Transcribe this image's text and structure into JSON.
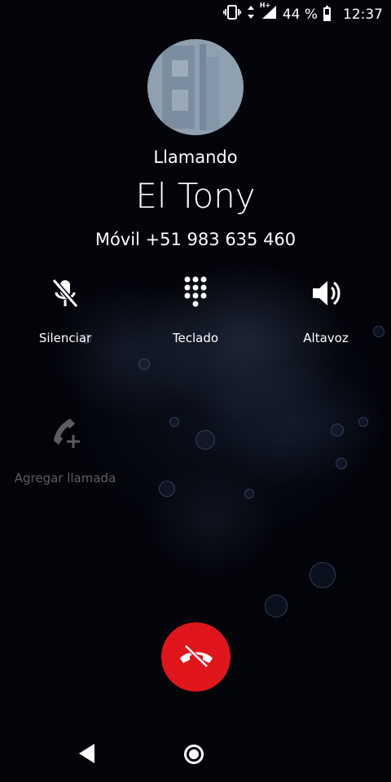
{
  "status_bar": {
    "battery_text": "44 %",
    "battery_level": 0.44,
    "network_type": "H+",
    "time": "12:37",
    "icons": [
      "vibrate-icon",
      "data-arrows-icon",
      "signal-icon",
      "battery-icon"
    ]
  },
  "call": {
    "state": "Llamando",
    "contact_name": "El Tony",
    "number_line": "Móvil +51 983 635 460"
  },
  "actions": [
    {
      "label": "Silenciar",
      "icon": "mute-mic-icon",
      "enabled": true
    },
    {
      "label": "Teclado",
      "icon": "dialpad-icon",
      "enabled": true
    },
    {
      "label": "Altavoz",
      "icon": "speaker-icon",
      "enabled": true
    },
    {
      "label": "Agregar llamada",
      "icon": "add-call-icon",
      "enabled": false
    }
  ],
  "end_call": {
    "icon": "end-call-icon",
    "color": "#e0161c"
  },
  "nav": {
    "back_icon": "back-icon",
    "home_icon": "home-icon"
  }
}
